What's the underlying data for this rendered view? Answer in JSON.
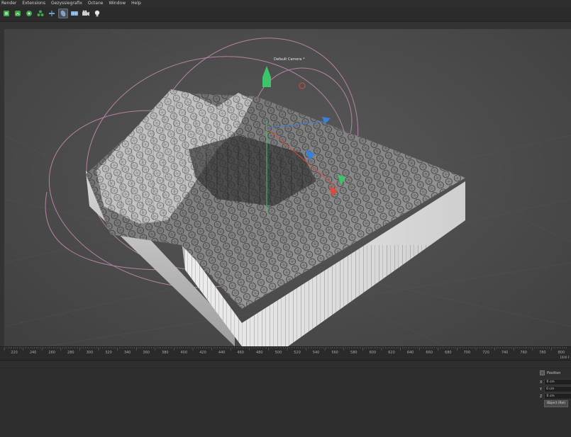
{
  "menu": [
    "Render",
    "Extensions",
    "Gezyssiegrafix",
    "Octane",
    "Window",
    "Help"
  ],
  "toolbar": {
    "buttons": [
      {
        "icon": "cube-primitive-icon",
        "color": "#3ea84a"
      },
      {
        "icon": "spline-icon",
        "color": "#3ea84a"
      },
      {
        "icon": "generator-icon",
        "color": "#3ea84a"
      },
      {
        "icon": "mograph-cloner-icon",
        "color": "#3ea84a"
      },
      {
        "icon": "deformer-icon",
        "color": "#6aa0d8"
      },
      {
        "icon": "scene-object-icon",
        "color": "#7fa4c8"
      },
      {
        "icon": "floor-icon",
        "color": "#7aa7d6"
      },
      {
        "icon": "camera-icon",
        "color": "#cfcfcf"
      },
      {
        "icon": "light-icon",
        "color": "#cfcfcf"
      }
    ]
  },
  "viewport": {
    "camera_label": "Default Camera *"
  },
  "timeline": {
    "ticks": [
      "220",
      "240",
      "260",
      "280",
      "300",
      "320",
      "340",
      "360",
      "380",
      "400",
      "420",
      "440",
      "460",
      "480",
      "500",
      "520",
      "540",
      "560",
      "580",
      "600",
      "620",
      "640",
      "660",
      "680",
      "700",
      "720",
      "740",
      "760",
      "780",
      "800"
    ],
    "end_label": "1000 F"
  },
  "attributes": {
    "position_label": "Position",
    "x_label": "X",
    "x_value": "0 cm",
    "y_label": "Y",
    "y_value": "0 cm",
    "z_label": "Z",
    "z_value": "0 cm",
    "mode_button": "Object (Rel)"
  },
  "colors": {
    "axis_x": "#e04a3c",
    "axis_y": "#3cc46a",
    "axis_z": "#3a7fd8",
    "orbit_lines": "#c78cb4"
  }
}
